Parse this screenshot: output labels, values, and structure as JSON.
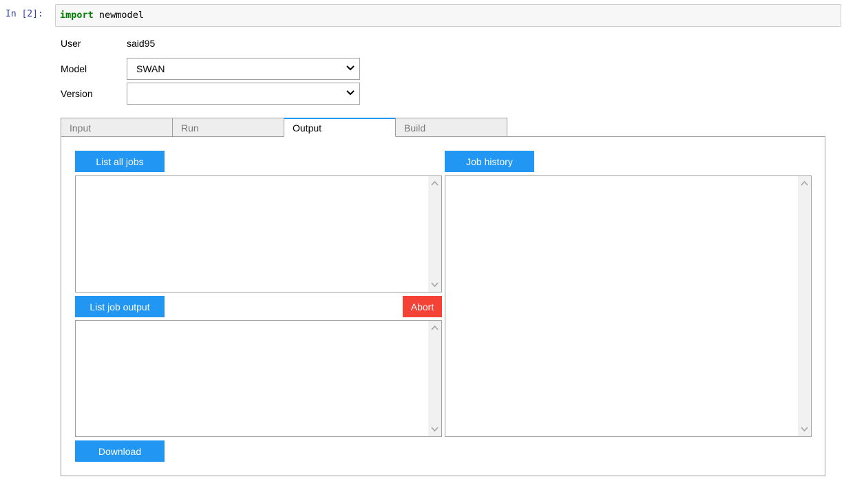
{
  "cell": {
    "prompt": "In [2]:",
    "code_keyword": "import",
    "code_module": "newmodel"
  },
  "form": {
    "user_label": "User",
    "user_value": "said95",
    "model_label": "Model",
    "model_value": "SWAN",
    "version_label": "Version",
    "version_value": ""
  },
  "tabs": [
    {
      "label": "Input"
    },
    {
      "label": "Run"
    },
    {
      "label": "Output"
    },
    {
      "label": "Build"
    }
  ],
  "active_tab": "Output",
  "output": {
    "list_all_jobs": "List all jobs",
    "job_history": "Job history",
    "list_job_output": "List job output",
    "abort": "Abort",
    "download": "Download"
  },
  "colors": {
    "button_blue": "#2196f3",
    "button_red": "#f44336",
    "keyword_green": "#008000",
    "prompt_blue": "#303f9f"
  }
}
